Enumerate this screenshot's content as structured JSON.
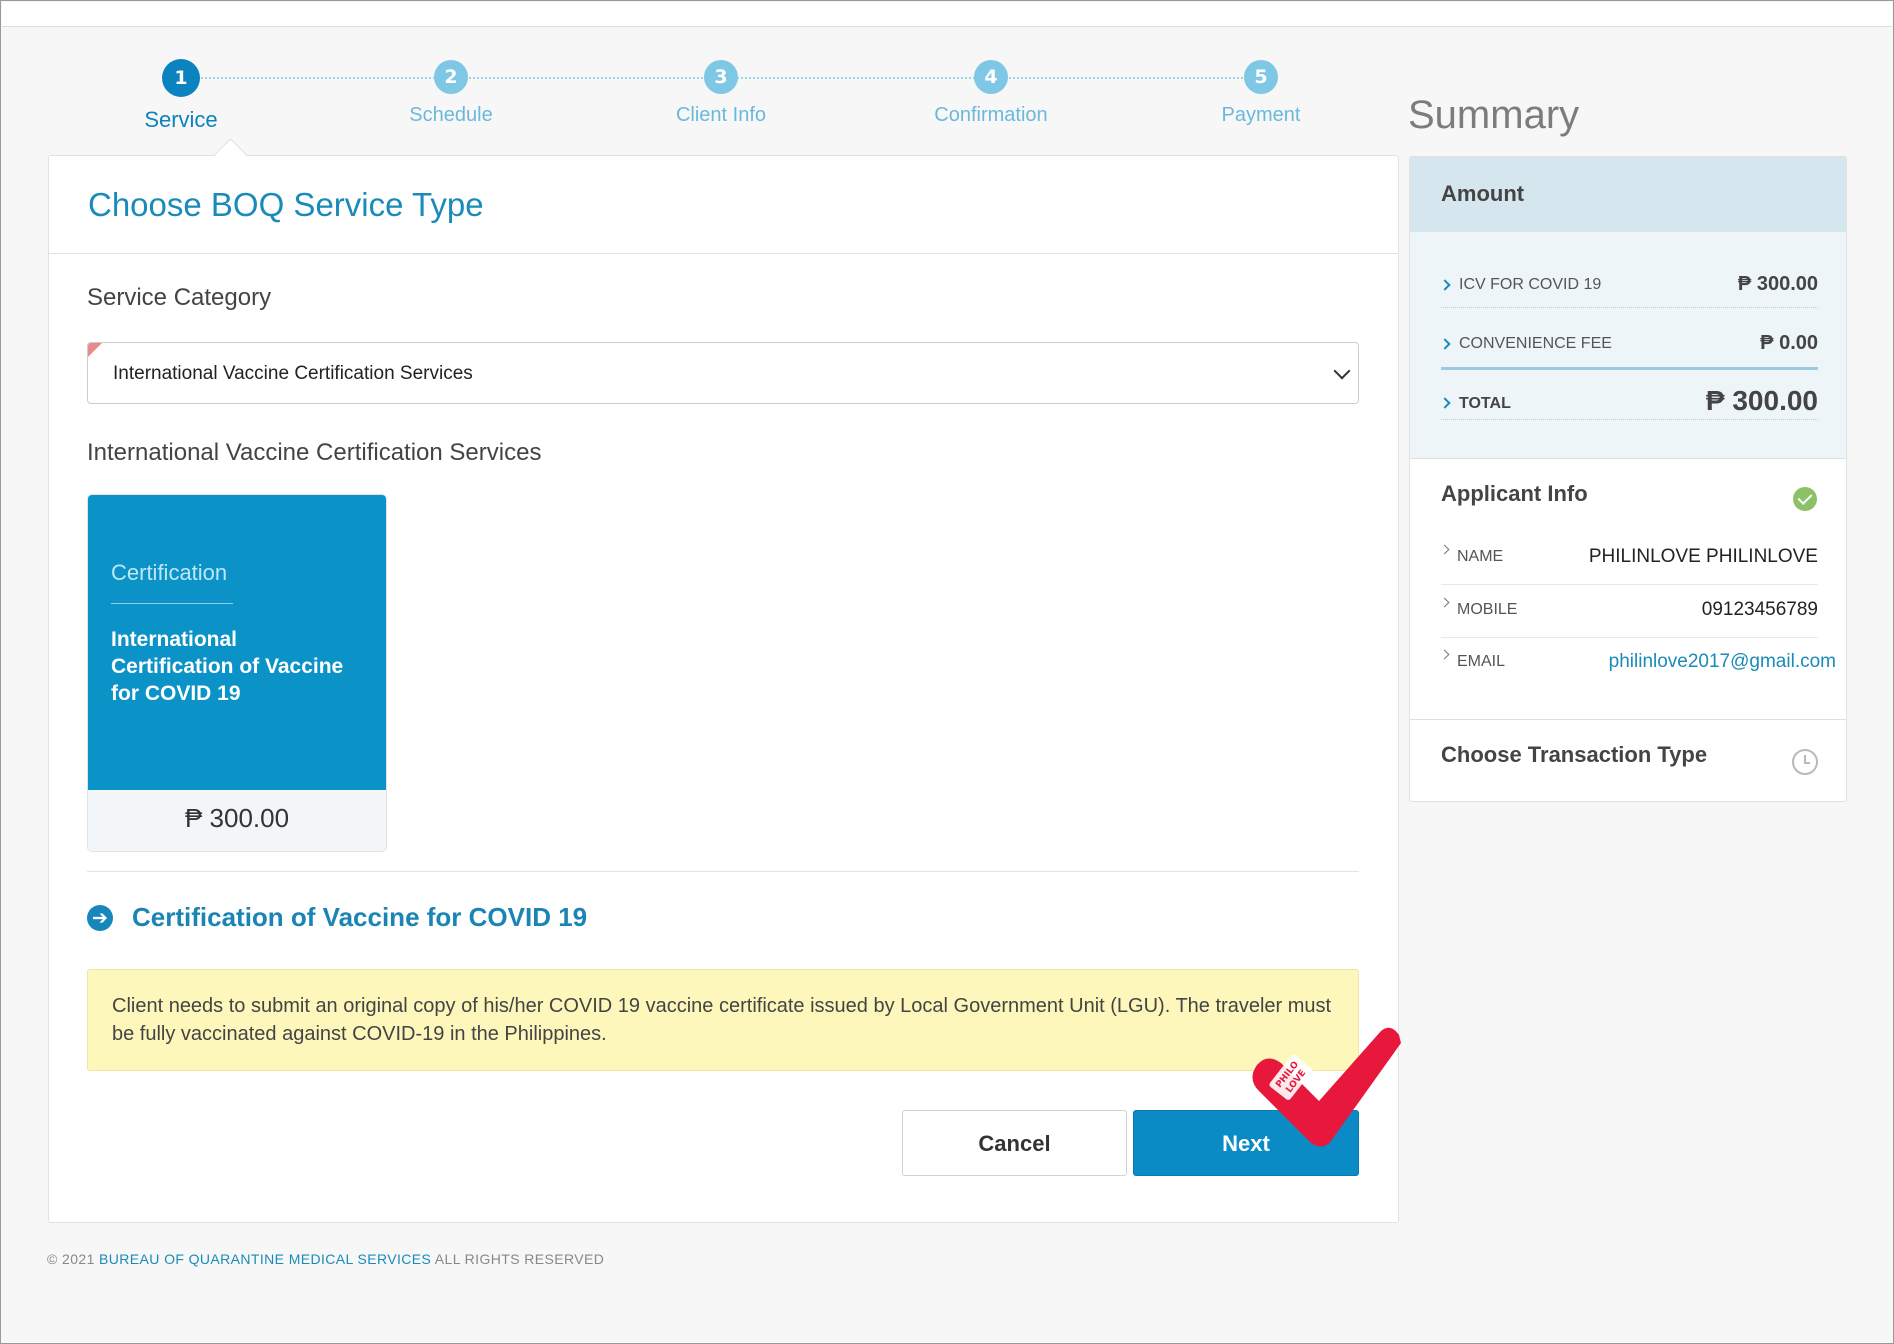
{
  "steps": [
    {
      "num": "1",
      "label": "Service",
      "active": true
    },
    {
      "num": "2",
      "label": "Schedule"
    },
    {
      "num": "3",
      "label": "Client Info"
    },
    {
      "num": "4",
      "label": "Confirmation"
    },
    {
      "num": "5",
      "label": "Payment"
    }
  ],
  "summary": {
    "title": "Summary",
    "amount": {
      "heading": "Amount",
      "rows": [
        {
          "name": "ICV FOR COVID 19",
          "value": "₱ 300.00"
        },
        {
          "name": "CONVENIENCE FEE",
          "value": "₱ 0.00"
        }
      ],
      "total": {
        "name": "TOTAL",
        "value": "₱ 300.00"
      }
    },
    "applicant": {
      "heading": "Applicant Info",
      "status_icon": "check-circle-icon",
      "rows": [
        {
          "name": "NAME",
          "value": "PHILINLOVE PHILINLOVE"
        },
        {
          "name": "MOBILE",
          "value": "09123456789"
        },
        {
          "name": "EMAIL",
          "value": "philinlove2017@gmail.com"
        }
      ]
    },
    "transaction": {
      "heading": "Choose Transaction Type",
      "status_icon": "clock-icon"
    }
  },
  "main": {
    "title": "Choose BOQ Service Type",
    "category_label": "Service Category",
    "category_selected": "International Vaccine Certification Services",
    "services_heading": "International Vaccine Certification Services",
    "service_card": {
      "category": "Certification",
      "name": "International Certification of Vaccine for COVID 19",
      "price": "₱ 300.00"
    },
    "detail_title": "Certification of Vaccine for COVID 19",
    "notice": "Client needs to submit an original copy of his/her COVID 19 vaccine certificate issued by Local Government Unit (LGU). The traveler must be fully vaccinated against COVID-19 in the Philippines.",
    "cancel_label": "Cancel",
    "next_label": "Next"
  },
  "watermark": {
    "text": "PHILO LOVE",
    "color": "#e8173c"
  },
  "footer": {
    "copyright": "© 2021",
    "org": "BUREAU OF QUARANTINE MEDICAL SERVICES",
    "rights": "ALL RIGHTS RESERVED"
  },
  "colors": {
    "primary": "#0b8bc5",
    "accent_blue": "#1a8bb8",
    "notice_bg": "#fdf7bc",
    "success": "#8dc167"
  }
}
